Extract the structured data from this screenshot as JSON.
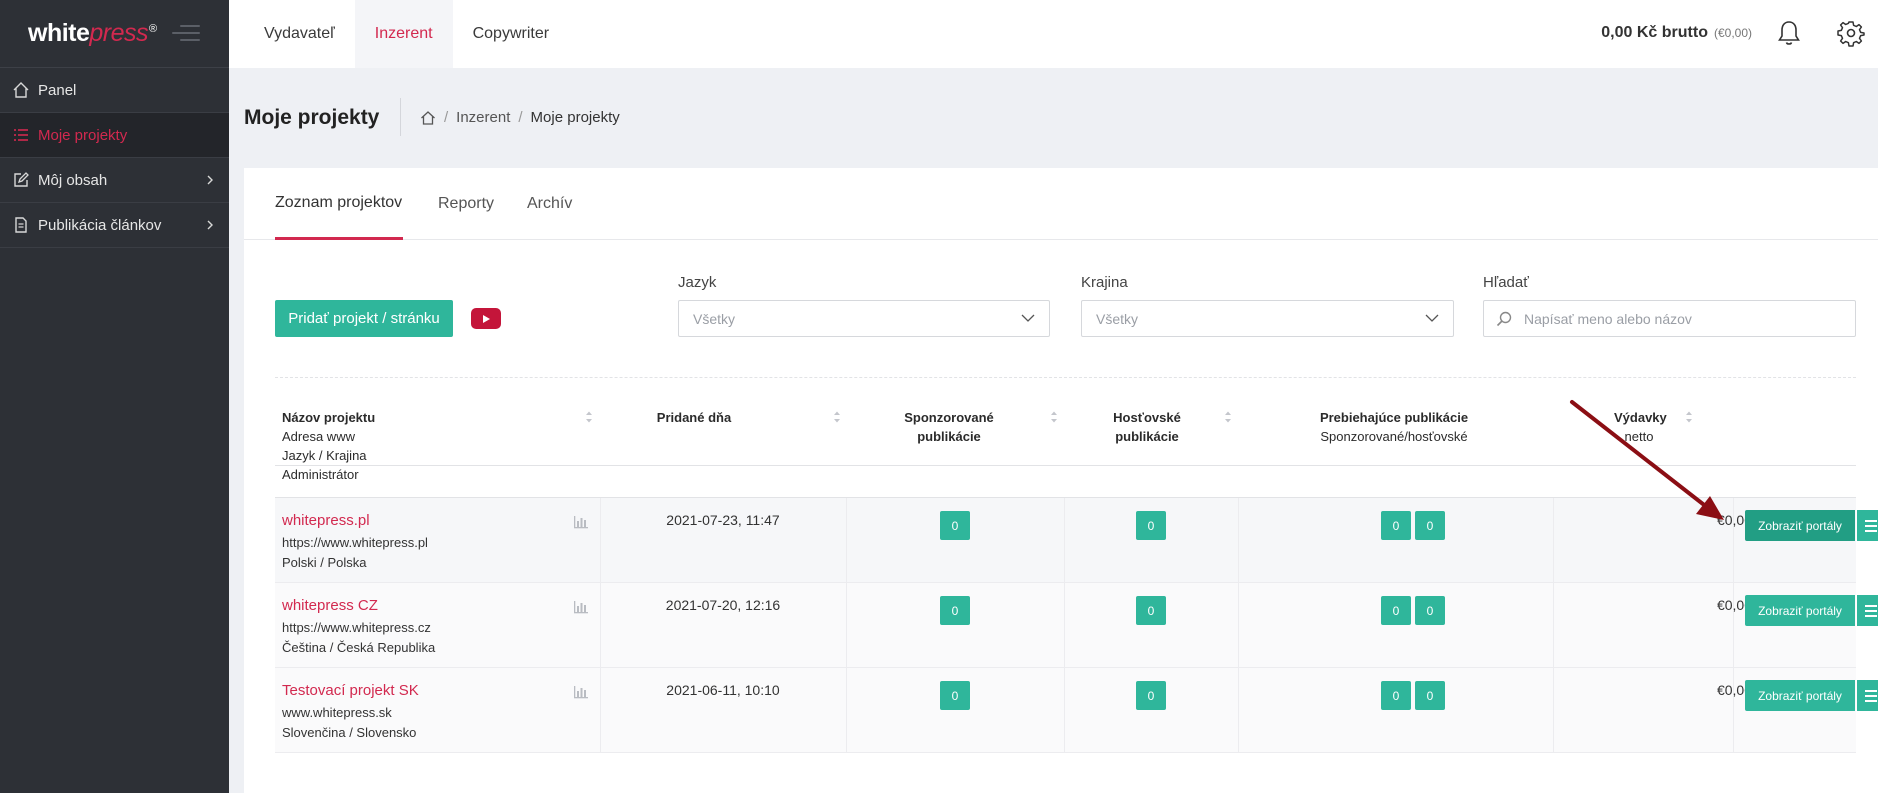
{
  "sidebar": {
    "logo": {
      "white": "white",
      "press": "press",
      "reg": "®"
    },
    "items": [
      {
        "label": "Panel",
        "icon": "home-icon"
      },
      {
        "label": "Moje projekty",
        "icon": "list-icon"
      },
      {
        "label": "Môj obsah",
        "icon": "edit-icon"
      },
      {
        "label": "Publikácia článkov",
        "icon": "document-icon"
      }
    ]
  },
  "topbar": {
    "tabs": [
      "Vydavateľ",
      "Inzerent",
      "Copywriter"
    ],
    "balance": "0,00 Kč brutto",
    "balance_eur": "(€0,00)"
  },
  "header": {
    "title": "Moje projekty",
    "breadcrumb": [
      "Inzerent",
      "Moje projekty"
    ]
  },
  "content_tabs": [
    "Zoznam projektov",
    "Reporty",
    "Archív"
  ],
  "toolbar": {
    "add_label": "Pridať projekt / stránku",
    "filters": {
      "language_label": "Jazyk",
      "language_value": "Všetky",
      "country_label": "Krajina",
      "country_value": "Všetky",
      "search_label": "Hľadať",
      "search_placeholder": "Napísať meno alebo názov"
    }
  },
  "table": {
    "headers": {
      "name": "Názov projektu",
      "name_sub": [
        "Adresa www",
        "Jazyk / Krajina",
        "Administrátor"
      ],
      "date": "Pridané dňa",
      "sponsored": [
        "Sponzorované",
        "publikácie"
      ],
      "guest": [
        "Hosťovské",
        "publikácie"
      ],
      "ongoing": "Prebiehajúce publikácie",
      "ongoing_sub": "Sponzorované/hosťovské",
      "spend": "Výdavky",
      "spend_sub": "netto"
    },
    "rows": [
      {
        "name": "whitepress.pl",
        "url": "https://www.whitepress.pl",
        "lang": "Polski / Polska",
        "date": "2021-07-23, 11:47",
        "sponsored": "0",
        "guest": "0",
        "ongoing_s": "0",
        "ongoing_g": "0",
        "spend": "€0,00",
        "action": "Zobraziť portály"
      },
      {
        "name": "whitepress CZ",
        "url": "https://www.whitepress.cz",
        "lang": "Čeština / Česká Republika",
        "date": "2021-07-20, 12:16",
        "sponsored": "0",
        "guest": "0",
        "ongoing_s": "0",
        "ongoing_g": "0",
        "spend": "€0,00",
        "action": "Zobraziť portály"
      },
      {
        "name": "Testovací projekt SK",
        "url": "www.whitepress.sk",
        "lang": "Slovenčina / Slovensko",
        "date": "2021-06-11, 10:10",
        "sponsored": "0",
        "guest": "0",
        "ongoing_s": "0",
        "ongoing_g": "0",
        "spend": "€0,00",
        "action": "Zobraziť portály"
      }
    ]
  },
  "colors": {
    "accent": "#d2294f",
    "green": "#2fb69b",
    "sidebar": "#2d3036",
    "arrow": "#8b0e14"
  }
}
